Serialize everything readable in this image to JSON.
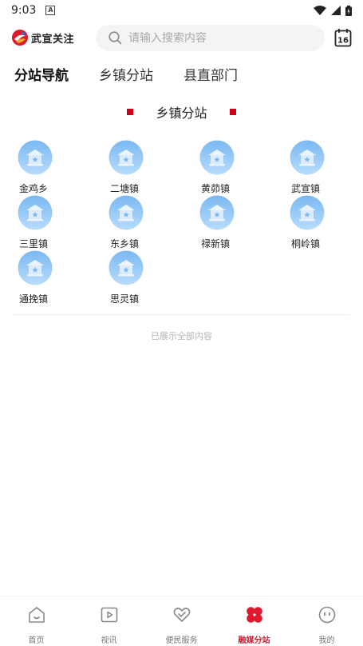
{
  "status_bar": {
    "time": "9:03",
    "notification_letter": "A"
  },
  "header": {
    "app_name": "武宣关注",
    "search_placeholder": "请输入搜索内容",
    "calendar_day": "16"
  },
  "tabs": [
    {
      "label": "分站导航",
      "active": true
    },
    {
      "label": "乡镇分站",
      "active": false
    },
    {
      "label": "县直部门",
      "active": false
    }
  ],
  "section": {
    "title": "乡镇分站"
  },
  "stations": [
    {
      "name": "金鸡乡"
    },
    {
      "name": "二塘镇"
    },
    {
      "name": "黄茆镇"
    },
    {
      "name": "武宣镇"
    },
    {
      "name": "三里镇"
    },
    {
      "name": "东乡镇"
    },
    {
      "name": "禄新镇"
    },
    {
      "name": "桐岭镇"
    },
    {
      "name": "通挽镇"
    },
    {
      "name": "思灵镇"
    }
  ],
  "list_end_text": "已展示全部内容",
  "bottom_nav": [
    {
      "label": "首页",
      "icon": "home-icon",
      "active": false
    },
    {
      "label": "视讯",
      "icon": "video-icon",
      "active": false
    },
    {
      "label": "便民服务",
      "icon": "heart-service-icon",
      "active": false
    },
    {
      "label": "融媒分站",
      "icon": "clover-icon",
      "active": true
    },
    {
      "label": "我的",
      "icon": "face-icon",
      "active": false
    }
  ],
  "colors": {
    "accent": "#e0192e",
    "section_marker": "#d0021b",
    "icon_blue": "#5aa2ec"
  }
}
